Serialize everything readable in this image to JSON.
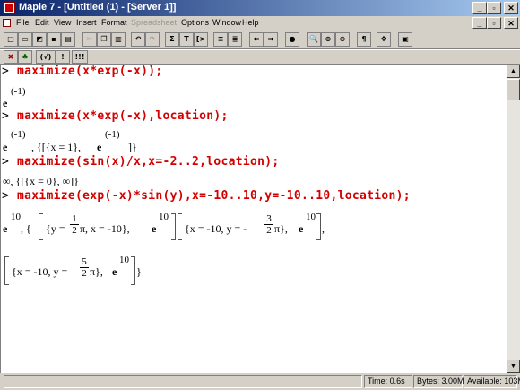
{
  "window": {
    "title": "Maple 7 - [Untitled (1) - [Server 1]]"
  },
  "menu": [
    {
      "label": "File",
      "enabled": true
    },
    {
      "label": "Edit",
      "enabled": true
    },
    {
      "label": "View",
      "enabled": true
    },
    {
      "label": "Insert",
      "enabled": true
    },
    {
      "label": "Format",
      "enabled": true
    },
    {
      "label": "Spreadsheet",
      "enabled": false
    },
    {
      "label": "Options",
      "enabled": true
    },
    {
      "label": "Window",
      "enabled": true
    },
    {
      "label": "Help",
      "enabled": true
    }
  ],
  "toolbar2": {
    "eval_label": "(√)",
    "exec_label": "!",
    "exec_all_label": "!!!"
  },
  "worksheet": {
    "prompt": ">",
    "cmd1": "maximize(x*exp(-x));",
    "cmd2": "maximize(x*exp(-x),location);",
    "cmd3": "maximize(sin(x)/x,x=-2..2,location);",
    "cmd4": "maximize(exp(-x)*sin(y),x=-10..10,y=-10..10,location);",
    "out1": {
      "base": "e",
      "exp": "(-1)"
    },
    "out2": {
      "base": "e",
      "exp": "(-1)",
      "mid": ", {[{x = 1}, ",
      "base2": "e",
      "exp2": "(-1)",
      "tail": "]}"
    },
    "out3": {
      "text": "∞, {[{x = 0}, ∞]}"
    },
    "out4": {
      "base": "e",
      "exp": "10",
      "p1a": ", {",
      "p1b": "{y = ",
      "frac1_num": "1",
      "frac1_den": "2",
      "p1c": "π, x = -10}, ",
      "p1e": "e",
      "p1e_exp": "10",
      "p2a": "{x = -10, y = -",
      "frac2_num": "3",
      "frac2_den": "2",
      "p2b": "π}, ",
      "p2e": "e",
      "p2e_exp": "10",
      "p2c": ","
    },
    "out5": {
      "p1": "{x = -10, y = ",
      "frac_num": "5",
      "frac_den": "2",
      "p2": "π}, ",
      "e": "e",
      "e_exp": "10",
      "tail": "}"
    }
  },
  "status": {
    "time": "Time:  0.6s",
    "bytes": "Bytes: 3.00M",
    "available": "Available: 103M"
  }
}
